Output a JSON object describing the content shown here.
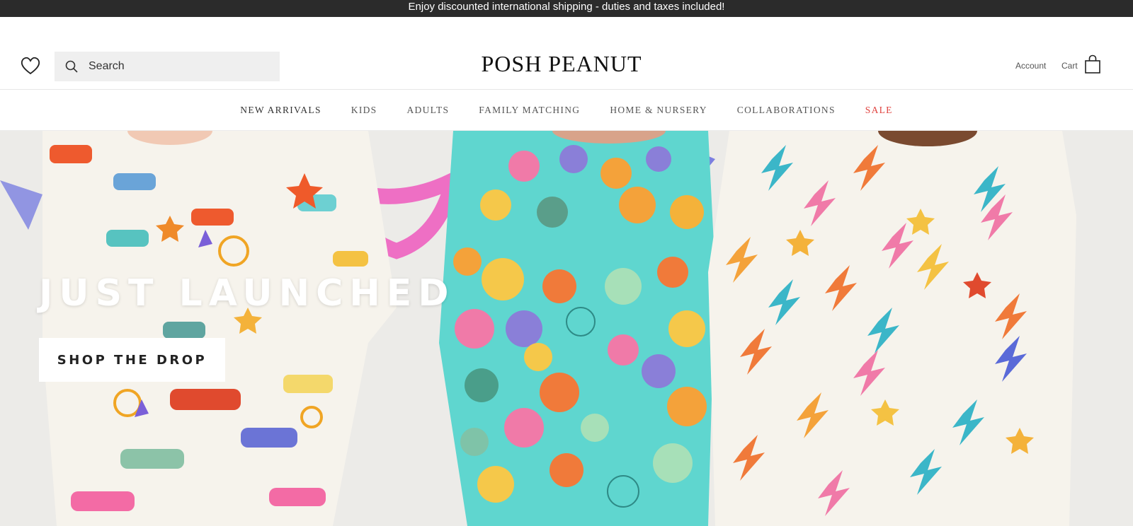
{
  "promo": {
    "text": "Enjoy discounted international shipping - duties and taxes included!"
  },
  "header": {
    "wishlist_icon": "heart-icon",
    "search": {
      "placeholder": "Search",
      "icon": "search-icon"
    },
    "logo": "POSH PEANUT",
    "account_label": "Account",
    "cart_label": "Cart",
    "cart_icon": "shopping-bag-icon"
  },
  "nav": {
    "items": [
      {
        "label": "NEW ARRIVALS"
      },
      {
        "label": "KIDS"
      },
      {
        "label": "ADULTS"
      },
      {
        "label": "FAMILY MATCHING"
      },
      {
        "label": "HOME & NURSERY"
      },
      {
        "label": "COLLABORATIONS"
      },
      {
        "label": "SALE"
      }
    ]
  },
  "hero": {
    "title": "JUST LAUNCHED",
    "cta_label": "SHOP THE DROP"
  },
  "colors": {
    "promo_bg": "#2b2b2b",
    "sale": "#e0433f",
    "search_bg": "#efefef",
    "turquoise_pajama": "#5fd6cf",
    "cream_pajama": "#f6f3ec"
  }
}
